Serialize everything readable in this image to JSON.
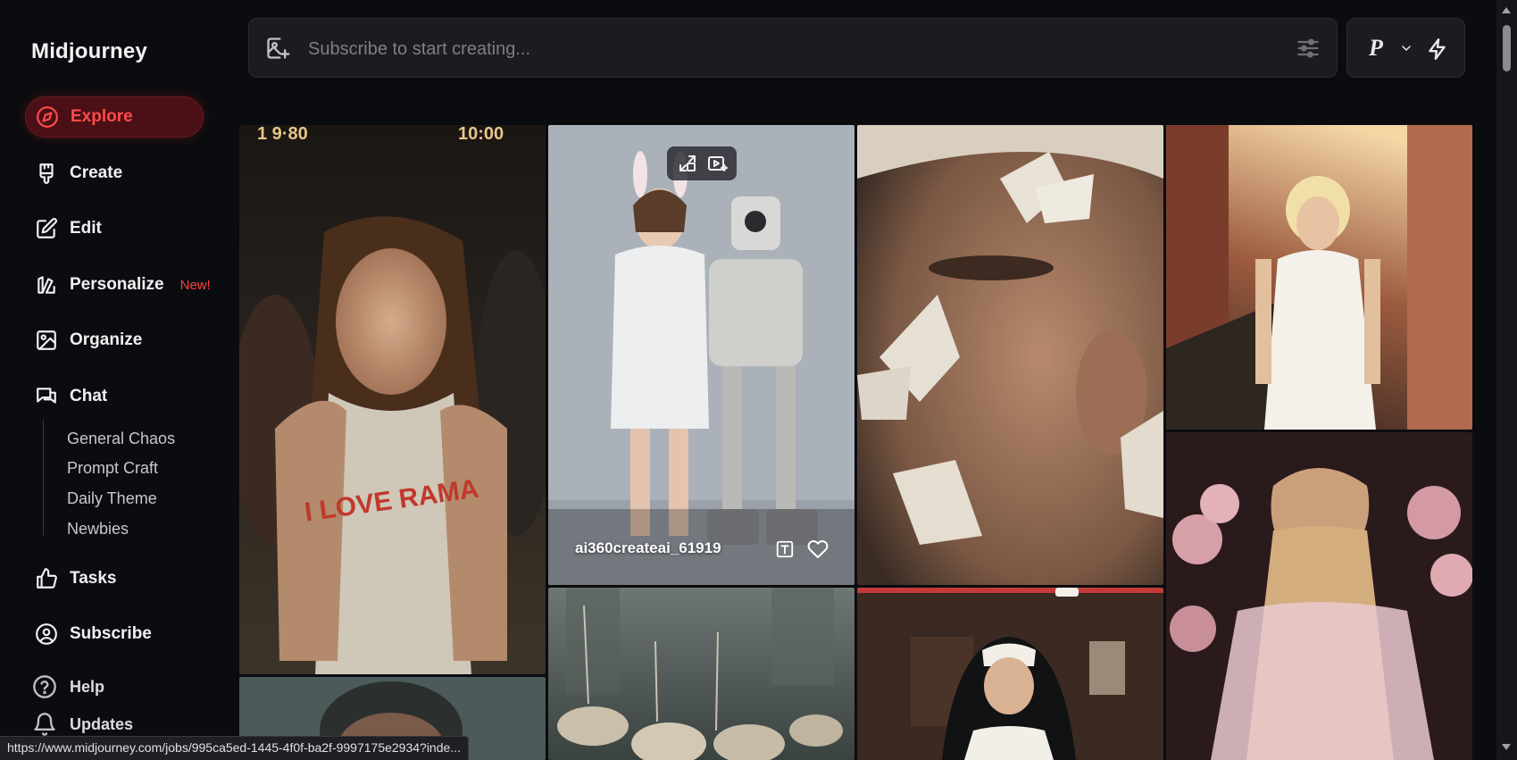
{
  "sidebar": {
    "brand": "Midjourney",
    "nav": [
      {
        "label": "Explore"
      },
      {
        "label": "Create"
      },
      {
        "label": "Edit"
      },
      {
        "label": "Personalize",
        "badge": "New!"
      },
      {
        "label": "Organize"
      },
      {
        "label": "Chat"
      }
    ],
    "chat_channels": [
      "General Chaos",
      "Prompt Craft",
      "Daily Theme",
      "Newbies"
    ],
    "nav_bottom": [
      {
        "label": "Tasks"
      },
      {
        "label": "Subscribe"
      }
    ],
    "utility": [
      {
        "label": "Help"
      },
      {
        "label": "Updates"
      }
    ]
  },
  "prompt": {
    "placeholder": "Subscribe to start creating..."
  },
  "mode": {
    "letter": "P"
  },
  "gallery": {
    "hovered_tile": {
      "username": "ai360createai_61919"
    },
    "tiles": [
      {
        "text": "I LOVE RAMA",
        "stamp_left": "1 9·80",
        "stamp_right": "10:00"
      }
    ]
  },
  "status_bar": {
    "url": "https://www.midjourney.com/jobs/995ca5ed-1445-4f0f-ba2f-9997175e2934?inde..."
  },
  "colors": {
    "accent": "#ff4b4b",
    "active_bg": "#4a1015",
    "background": "#0b0c0f",
    "panel": "#1b1c21"
  }
}
